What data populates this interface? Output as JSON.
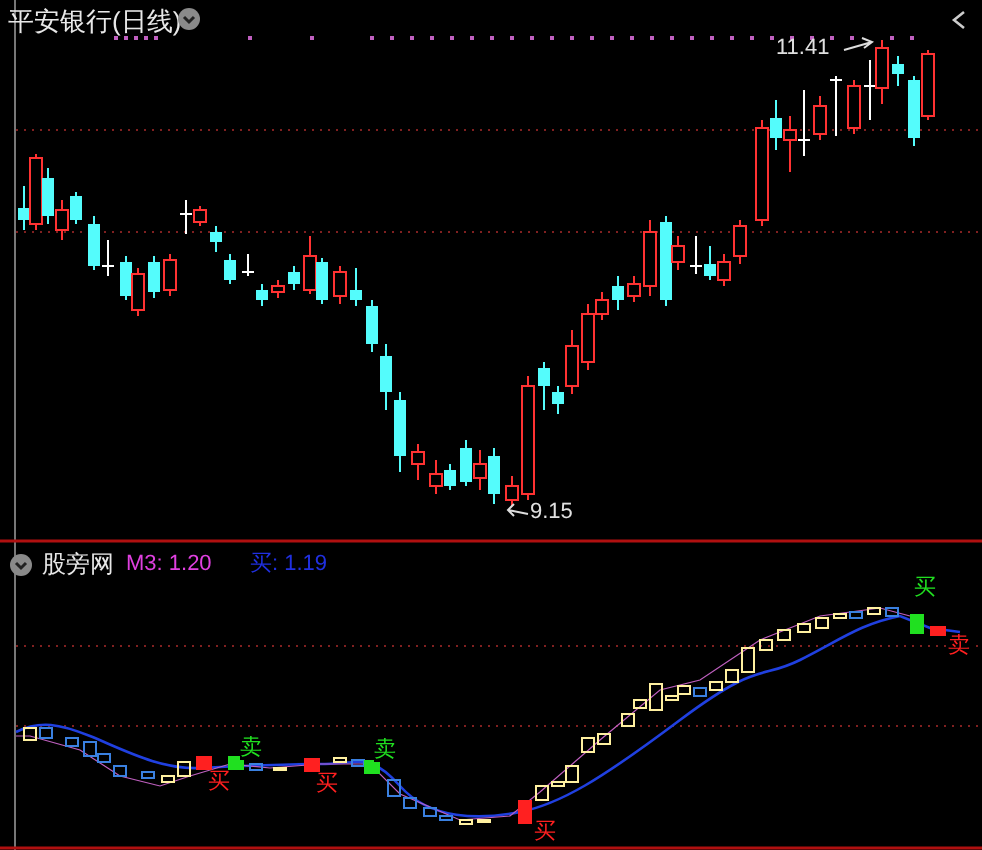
{
  "header": {
    "title": "平安银行(日线)"
  },
  "price_chart": {
    "high_label": "11.41",
    "low_label": "9.15"
  },
  "indicator": {
    "name": "股旁网",
    "m3_label": "M3: 1.20",
    "buy_label": "买: 1.19",
    "signals": [
      {
        "text": "买",
        "color": "#ff2020"
      },
      {
        "text": "卖",
        "color": "#20e020"
      },
      {
        "text": "买",
        "color": "#ff2020"
      },
      {
        "text": "卖",
        "color": "#20e020"
      },
      {
        "text": "买",
        "color": "#ff2020"
      },
      {
        "text": "买",
        "color": "#20e020"
      },
      {
        "text": "卖",
        "color": "#ff2020"
      }
    ]
  }
}
